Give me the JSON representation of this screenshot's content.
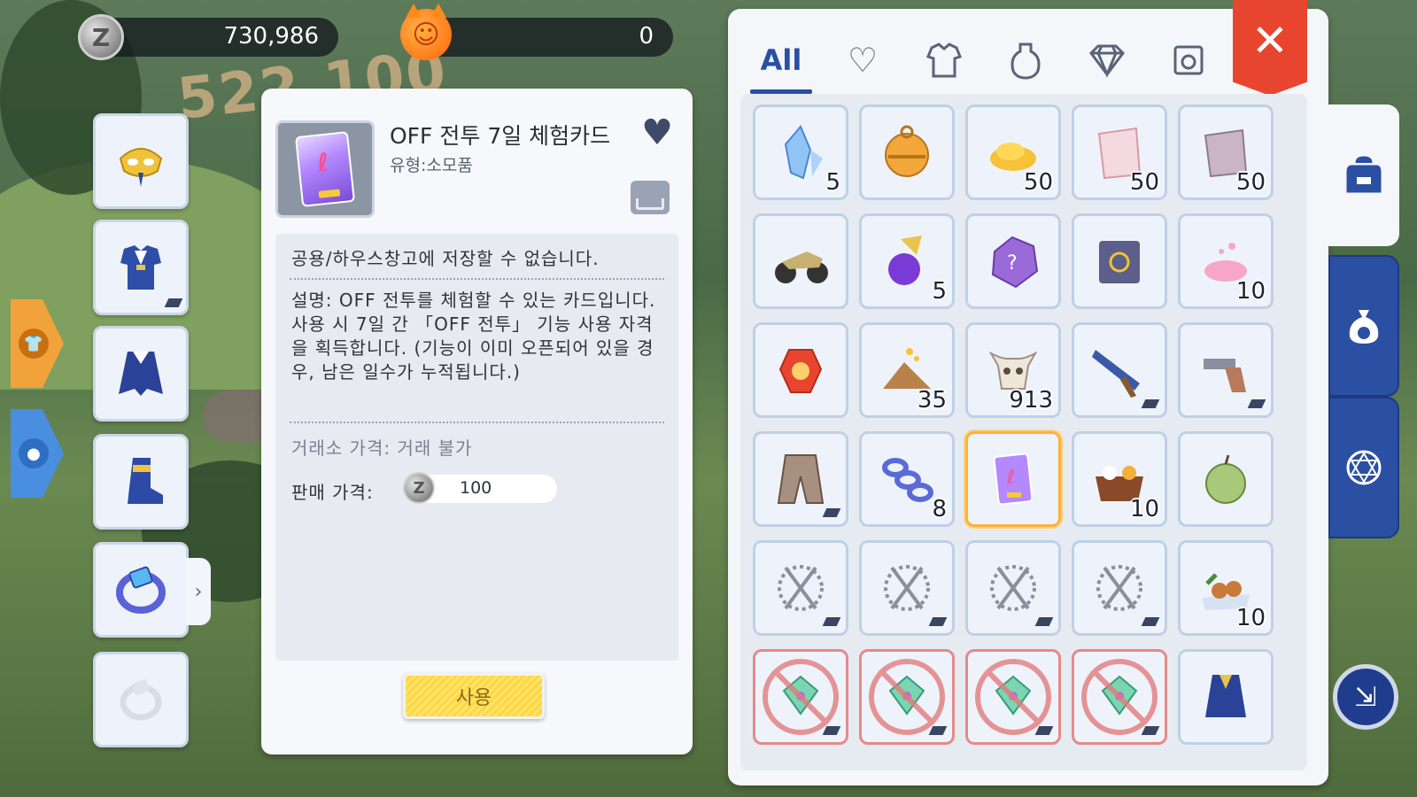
{
  "currency": {
    "zeny_symbol": "Z",
    "zeny_value": "730,986",
    "cat_coin_value": "0"
  },
  "background": {
    "damage_text": "522,100"
  },
  "equipment": {
    "slots": [
      {
        "name": "headgear",
        "icon": "golden-mask-icon"
      },
      {
        "name": "armor",
        "icon": "blue-armor-icon"
      },
      {
        "name": "garment",
        "icon": "blue-cloak-icon"
      },
      {
        "name": "shoes",
        "icon": "blue-boots-icon"
      },
      {
        "name": "accessory",
        "icon": "blue-ring-icon"
      },
      {
        "name": "accessory-empty",
        "icon": "ring-outline-icon"
      }
    ],
    "expand_arrow": "›",
    "side_buttons": [
      "shirt-icon",
      "person-icon"
    ]
  },
  "detail": {
    "name": "OFF 전투 7일 체험카드",
    "type": "유형:소모품",
    "warning": "공용/하우스창고에 저장할 수 없습니다.",
    "description": "설명: OFF 전투를 체험할 수 있는 카드입니다. 사용 시 7일 간 「OFF 전투」 기능 사용 자격을 획득합니다. (기능이 이미 오픈되어 있을 경우, 남은 일수가 누적됩니다.)",
    "trade_price": "거래소 가격: 거래 불가",
    "sell_label": "판매 가격:",
    "sell_value": "100",
    "use_button": "사용"
  },
  "inventory": {
    "tabs": [
      {
        "label": "All",
        "icon": "all-text",
        "active": true
      },
      {
        "label": "",
        "icon": "heart-icon",
        "active": false
      },
      {
        "label": "",
        "icon": "armor-icon",
        "active": false
      },
      {
        "label": "",
        "icon": "potion-icon",
        "active": false
      },
      {
        "label": "",
        "icon": "diamond-icon",
        "active": false
      },
      {
        "label": "",
        "icon": "card-icon",
        "active": false
      }
    ],
    "close_label": "✕",
    "items": [
      {
        "icon": "blue-crystal-icon",
        "count": "5",
        "tag": false,
        "locked": false,
        "selected": false
      },
      {
        "icon": "golden-bell-icon",
        "count": "",
        "tag": false,
        "locked": false,
        "selected": false
      },
      {
        "icon": "gold-powder-icon",
        "count": "50",
        "tag": false,
        "locked": false,
        "selected": false
      },
      {
        "icon": "pink-plate-icon",
        "count": "50",
        "tag": false,
        "locked": false,
        "selected": false
      },
      {
        "icon": "purple-plate-icon",
        "count": "50",
        "tag": false,
        "locked": false,
        "selected": false
      },
      {
        "icon": "motorcycle-icon",
        "count": "",
        "tag": false,
        "locked": false,
        "selected": false
      },
      {
        "icon": "purple-potion-icon",
        "count": "5",
        "tag": false,
        "locked": false,
        "selected": false
      },
      {
        "icon": "mystery-stone-icon",
        "count": "",
        "tag": false,
        "locked": false,
        "selected": false
      },
      {
        "icon": "album-icon",
        "count": "",
        "tag": false,
        "locked": false,
        "selected": false
      },
      {
        "icon": "pink-dust-icon",
        "count": "10",
        "tag": false,
        "locked": false,
        "selected": false
      },
      {
        "icon": "fire-crystal-icon",
        "count": "",
        "tag": false,
        "locked": false,
        "selected": false
      },
      {
        "icon": "gold-sand-icon",
        "count": "35",
        "tag": false,
        "locked": false,
        "selected": false
      },
      {
        "icon": "ox-skull-icon",
        "count": "913",
        "tag": false,
        "locked": false,
        "selected": false
      },
      {
        "icon": "rifle-icon",
        "count": "",
        "tag": true,
        "locked": false,
        "selected": false
      },
      {
        "icon": "revolver-icon",
        "count": "",
        "tag": true,
        "locked": false,
        "selected": false
      },
      {
        "icon": "coat-icon",
        "count": "",
        "tag": true,
        "locked": false,
        "selected": false
      },
      {
        "icon": "chain-icon",
        "count": "8",
        "tag": false,
        "locked": false,
        "selected": false
      },
      {
        "icon": "experience-card-icon",
        "count": "",
        "tag": false,
        "locked": false,
        "selected": true
      },
      {
        "icon": "lunch-box-icon",
        "count": "10",
        "tag": false,
        "locked": false,
        "selected": false
      },
      {
        "icon": "apple-icon",
        "count": "",
        "tag": false,
        "locked": false,
        "selected": false
      },
      {
        "icon": "rosary-icon",
        "count": "",
        "tag": true,
        "locked": false,
        "selected": false
      },
      {
        "icon": "rosary-icon",
        "count": "",
        "tag": true,
        "locked": false,
        "selected": false
      },
      {
        "icon": "rosary-icon",
        "count": "",
        "tag": true,
        "locked": false,
        "selected": false
      },
      {
        "icon": "rosary-icon",
        "count": "",
        "tag": true,
        "locked": false,
        "selected": false
      },
      {
        "icon": "food-platter-icon",
        "count": "10",
        "tag": false,
        "locked": false,
        "selected": false
      },
      {
        "icon": "green-gem-icon",
        "count": "",
        "tag": true,
        "locked": true,
        "selected": false
      },
      {
        "icon": "green-gem-icon",
        "count": "",
        "tag": true,
        "locked": true,
        "selected": false
      },
      {
        "icon": "green-gem-icon",
        "count": "",
        "tag": true,
        "locked": true,
        "selected": false
      },
      {
        "icon": "green-gem-icon",
        "count": "",
        "tag": true,
        "locked": true,
        "selected": false
      },
      {
        "icon": "blue-vest-icon",
        "count": "",
        "tag": false,
        "locked": false,
        "selected": false
      }
    ]
  },
  "side_tabs": [
    {
      "icon": "backpack-icon",
      "active": true
    },
    {
      "icon": "zeny-bag-icon",
      "active": false
    },
    {
      "icon": "magic-circle-icon",
      "active": false
    }
  ],
  "corner_button": {
    "icon": "minimize-icon"
  },
  "colors": {
    "accent": "#2a4fa3",
    "close": "#e8452f",
    "use_button": "#ffd63f",
    "selected_border": "#ffb13d",
    "locked_border": "#e48a8a"
  }
}
